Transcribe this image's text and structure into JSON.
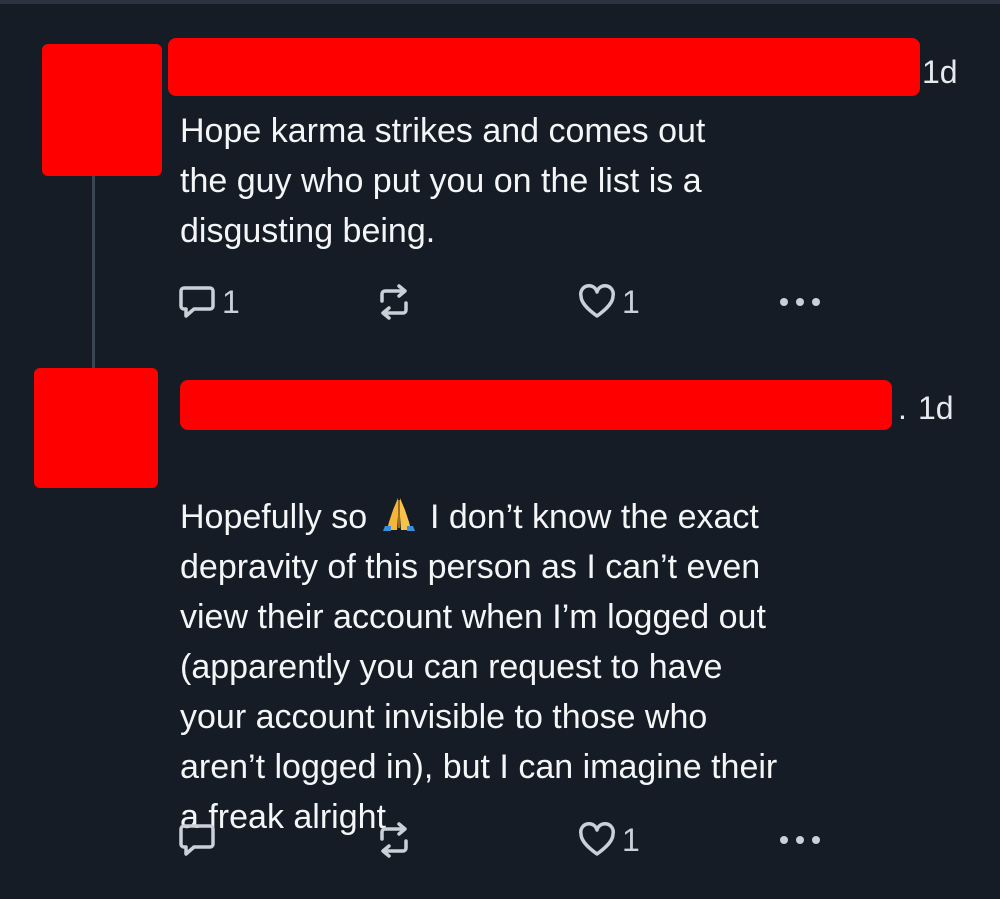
{
  "posts": [
    {
      "time": "1d",
      "body": "Hope karma strikes and comes out\nthe guy who put you on the list is a\ndisgusting being.",
      "reply_count": "1",
      "like_count": "1",
      "icons": [
        "reply-icon",
        "repost-icon",
        "heart-icon",
        "more-icon"
      ]
    },
    {
      "time_prefix": ".",
      "time": "1d",
      "body_before_emoji": "Hopefully so ",
      "emoji": "folded-hands",
      "body_after_emoji": " I don’t know the exact\ndepravity of this person as I can’t even\nview their account when I’m logged out\n(apparently you can request to have\nyour account invisible to those who\naren’t logged in), but I can imagine their\na freak alright",
      "like_count": "1",
      "icons": [
        "reply-icon",
        "repost-icon",
        "heart-icon",
        "more-icon"
      ]
    }
  ],
  "colors": {
    "background": "#161c25",
    "redaction": "#ff0000",
    "text": "#f3f5f7",
    "icon": "#c9d0d8",
    "thread_line": "#3a4552"
  }
}
